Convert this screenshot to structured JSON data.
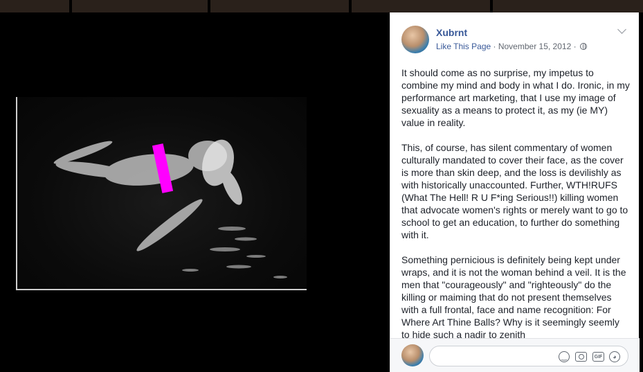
{
  "post": {
    "author": "Xubrnt",
    "like_link": "Like This Page",
    "separator": " · ",
    "date": "November 15, 2012",
    "separator2": " · ",
    "paragraphs": [
      "It should come as no surprise, my impetus to combine my mind and body in what I do. Ironic, in my performance art marketing, that I use my image of sexuality as a means to protect it, as my (ie MY) value in reality.",
      "This, of course, has silent commentary of women culturally mandated to cover their face, as the cover is more than skin deep, and the loss is devilishly as with historically unaccounted. Further, WTH!RUFS (What The Hell! R U F*ing Serious!!) killing women that advocate women's rights or merely want to go to school to get an education, to further do something with it.",
      "Something pernicious is definitely being kept under wraps, and it is not the woman behind a veil. It is the men that \"courageously\" and \"righteously\" do the killing or maiming that do not present themselves with a full frontal, face and name recognition: For Where Art Thine Balls? Why is it seemingly seemly to hide such a nadir to zenith"
    ]
  },
  "icons": {
    "privacy": "globe-icon",
    "options": "chevron-down-icon",
    "emoji": "emoji-icon",
    "camera": "camera-icon",
    "gif": "gif-icon",
    "sticker": "sticker-icon"
  },
  "comment": {
    "placeholder": "",
    "gif_label": "GIF"
  },
  "colors": {
    "link": "#385898",
    "censor_bar": "#ff00ff",
    "background": "#000000"
  }
}
